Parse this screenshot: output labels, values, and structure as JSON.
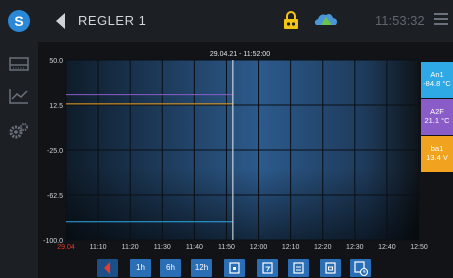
{
  "header": {
    "title": "REGLER 1",
    "time": "11:53:32"
  },
  "chart_data": {
    "type": "line",
    "cursor_label": "29.04.21 - 11:52:00",
    "y_ticks": [
      "50.0",
      "12.5",
      "-25.0",
      "-62.5",
      "-100.0"
    ],
    "x_ticks": [
      "29.04",
      "11:10",
      "11:20",
      "11:30",
      "11:40",
      "11:50",
      "12:00",
      "12:10",
      "12:20",
      "12:30",
      "12:40",
      "12:50"
    ],
    "ylim": [
      -100,
      50
    ],
    "series": [
      {
        "name": "An1",
        "color": "#2fa8e6",
        "values": [
          -84.8
        ]
      },
      {
        "name": "A2F",
        "color": "#8a5cc8",
        "values": [
          21.1
        ]
      },
      {
        "name": "ba1",
        "color": "#f1a31f",
        "values": [
          13.4
        ]
      }
    ]
  },
  "legend": [
    {
      "name": "An1",
      "value": "-84.8 °C",
      "color": "#2fa8e6"
    },
    {
      "name": "A2F",
      "value": "21.1 °C",
      "color": "#8a5cc8"
    },
    {
      "name": "ba1",
      "value": "13.4 V",
      "color": "#f1a31f"
    }
  ],
  "toolbar": {
    "btn_1h": "1h",
    "btn_6h": "6h",
    "btn_12h": "12h"
  }
}
